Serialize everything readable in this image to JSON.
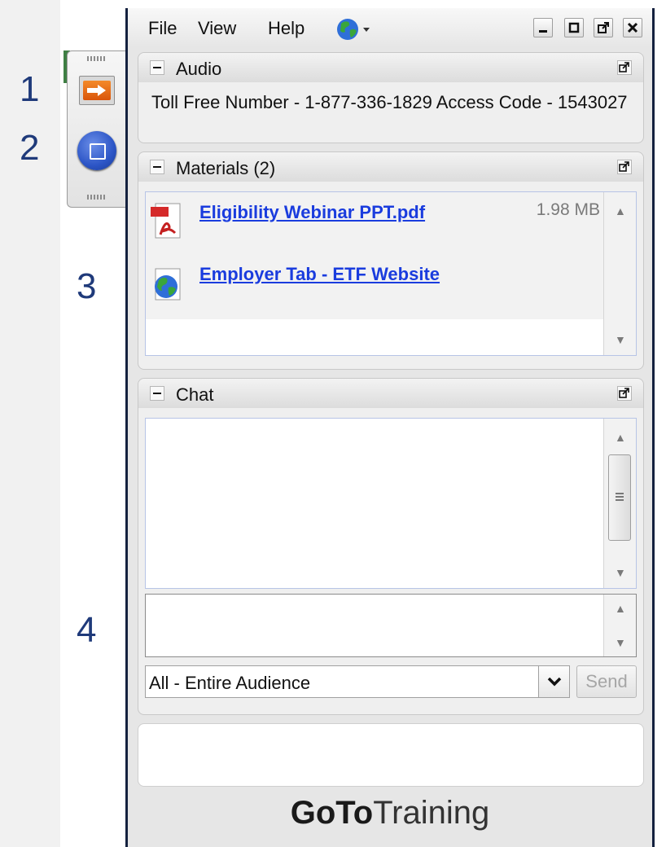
{
  "markers": [
    "1",
    "2",
    "3",
    "4"
  ],
  "menu": {
    "file": "File",
    "view": "View",
    "help": "Help"
  },
  "control_panel": {
    "arrow_button_icon": "orange-arrow-icon",
    "round_button_icon": "blue-square-icon"
  },
  "audio": {
    "title": "Audio",
    "text": "Toll Free Number - 1-877-336-1829 Access Code - 1543027"
  },
  "materials": {
    "title": "Materials (2)",
    "items": [
      {
        "name": "Eligibility Webinar PPT.pdf",
        "size": "1.98 MB",
        "icon": "pdf-icon"
      },
      {
        "name": "Employer Tab - ETF Website",
        "size": "",
        "icon": "web-link-globe-icon"
      }
    ]
  },
  "chat": {
    "title": "Chat",
    "audience": "All - Entire Audience",
    "send_label": "Send"
  },
  "brand": {
    "bold": "GoTo",
    "light": "Training"
  },
  "colors": {
    "link": "#1a3cde",
    "window_border": "#14213f",
    "marker": "#1f3a7a",
    "arrow_orange": "#e86a18",
    "round_blue": "#2c55c6"
  }
}
